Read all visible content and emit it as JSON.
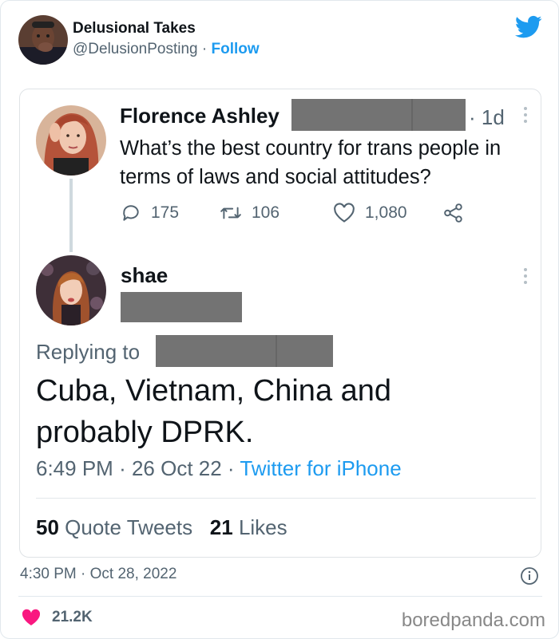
{
  "outer_tweet": {
    "author_name": "Delusional Takes",
    "author_handle": "@DelusionPosting",
    "separator": "·",
    "follow_label": "Follow",
    "timestamp": "4:30 PM · Oct 28, 2022",
    "like_count": "21.2K",
    "icons": [
      "twitter-bird-icon",
      "info-icon",
      "heart-icon"
    ],
    "colors": {
      "accent": "#1d9bf0",
      "heart": "#f91880",
      "text": "#0f1419",
      "muted": "#536471"
    }
  },
  "screenshot": {
    "original_tweet": {
      "author_name": "Florence Ashley",
      "time": "· 1d",
      "text": "What’s the best country for trans people in terms of laws and social attitudes?",
      "replies": "175",
      "retweets": "106",
      "likes": "1,080"
    },
    "reply_tweet": {
      "author_name": "shae",
      "replying_to_label": "Replying to",
      "text": "Cuba, Vietnam, China and probably DPRK.",
      "time": "6:49 PM",
      "date": "26 Oct 22",
      "source": "Twitter for iPhone",
      "quote_tweets_count": "50",
      "quote_tweets_label": "Quote Tweets",
      "likes_count": "21",
      "likes_label": "Likes"
    }
  },
  "watermark": "boredpanda.com"
}
